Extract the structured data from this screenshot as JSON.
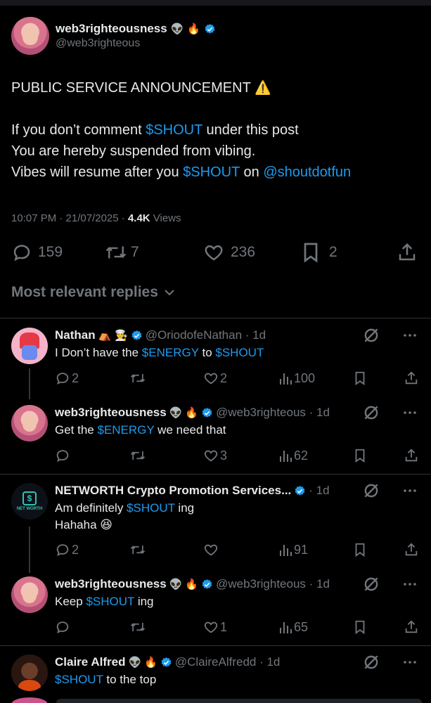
{
  "post": {
    "author_name": "web3righteousness",
    "author_handle": "@web3righteous",
    "lines": {
      "l1": "PUBLIC SERVICE ANNOUNCEMENT",
      "l1_emoji": "⚠️",
      "l2_a": "If you don’t comment ",
      "l2_tag": "$SHOUT",
      "l2_b": " under this post",
      "l3": "You are hereby suspended from vibing.",
      "l4_a": "Vibes will resume after you ",
      "l4_tag": "$SHOUT",
      "l4_b": " on ",
      "l4_mention": "@shoutdotfun"
    },
    "timestamp": "10:07 PM · 21/07/2025 · ",
    "views_count": "4.4K",
    "views_label": " Views",
    "replies": "159",
    "reposts": "7",
    "likes": "236",
    "bookmarks": "2"
  },
  "sort_label": "Most relevant replies",
  "replies": [
    {
      "name": "Nathan",
      "badges": "⛺ 👨‍🍳",
      "handle": "@OriodofeNathan · 1d",
      "text_a": "I Don’t have the ",
      "tag1": "$ENERGY",
      "text_b": " to ",
      "tag2": "$SHOUT",
      "replies": "2",
      "likes": "2",
      "views": "100"
    },
    {
      "name": "web3righteousness",
      "handle": "@web3righteous · 1d",
      "text_a": "Get the ",
      "tag1": "$ENERGY",
      "text_b": " we need that",
      "replies": "",
      "likes": "3",
      "views": "62"
    },
    {
      "name": "NETWORTH Crypto Promotion Services...",
      "handle": "· 1d",
      "text_a": "Am definitely ",
      "tag1": "$SHOUT",
      "text_b": " ing",
      "text_line2": "Hahaha 😆",
      "avatar_text": "NET WORTH",
      "replies": "2",
      "likes": "",
      "views": "91"
    },
    {
      "name": "web3righteousness",
      "handle": "@web3righteous · 1d",
      "text_a": "Keep ",
      "tag1": "$SHOUT",
      "text_b": " ing",
      "replies": "",
      "likes": "1",
      "views": "65"
    },
    {
      "name": "Claire Alfred",
      "handle": "@ClaireAlfredd · 1d",
      "tag1": "$SHOUT",
      "text_b": " to the top"
    }
  ],
  "colors": {
    "accent": "#1d9bf0",
    "muted": "#71767b",
    "background": "#000000"
  },
  "icons": [
    "verified-badge-icon",
    "alien-emoji-icon",
    "fire-emoji-icon",
    "reply-icon",
    "repost-icon",
    "like-icon",
    "bookmark-icon",
    "share-icon",
    "views-icon",
    "grok-icon",
    "more-icon",
    "chevron-down-icon"
  ]
}
